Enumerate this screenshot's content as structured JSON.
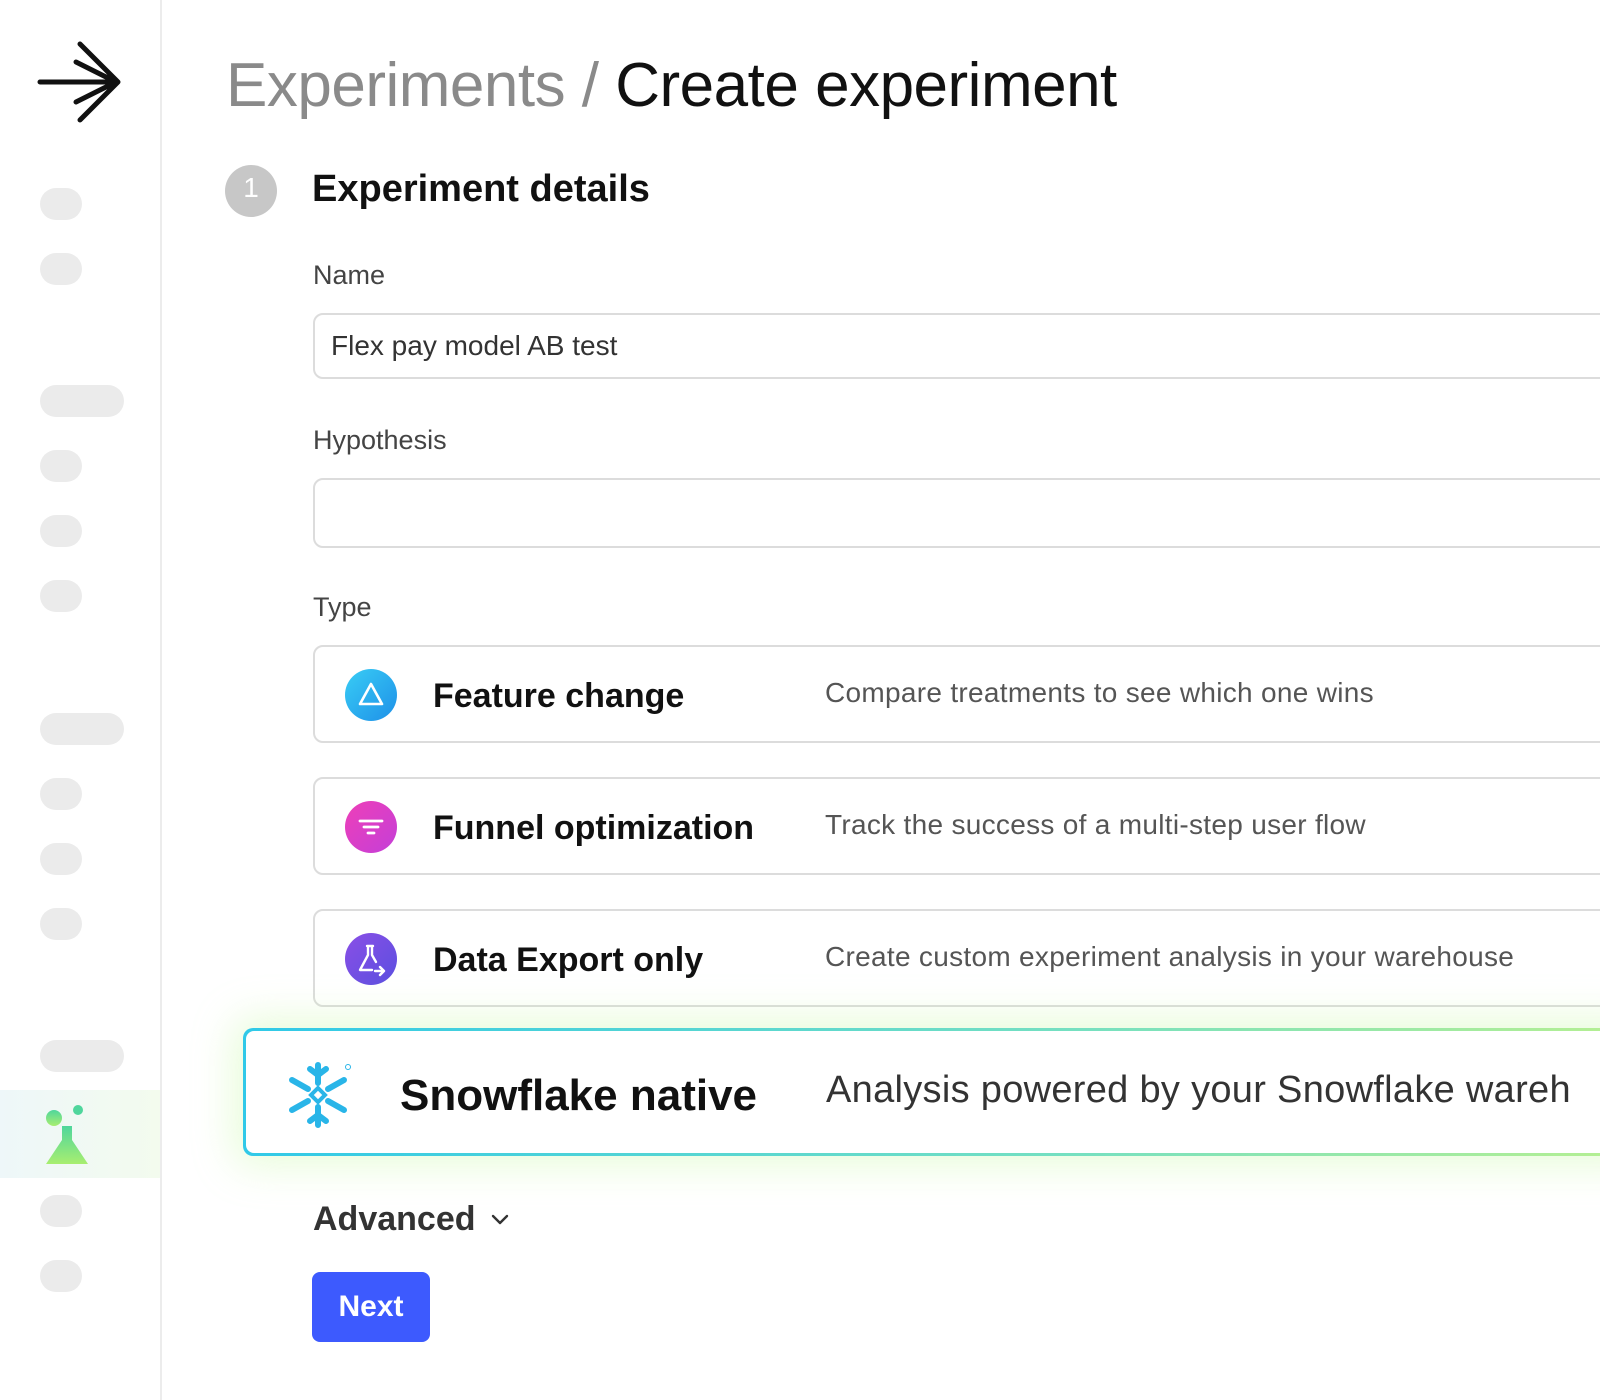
{
  "breadcrumb": {
    "parent": "Experiments",
    "separator": " / ",
    "current": "Create experiment"
  },
  "step": {
    "number": "1",
    "title": "Experiment details"
  },
  "form": {
    "name_label": "Name",
    "name_value": "Flex pay model AB test",
    "hypothesis_label": "Hypothesis",
    "hypothesis_value": "",
    "type_label": "Type"
  },
  "types": [
    {
      "name": "Feature change",
      "description": "Compare treatments to see which one wins",
      "icon": "triangle-icon",
      "color": "#2fb6ef"
    },
    {
      "name": "Funnel optimization",
      "description": "Track the success of a multi-step user flow",
      "icon": "funnel-icon",
      "color": "#d640c8"
    },
    {
      "name": "Data Export only",
      "description": "Create custom experiment analysis in your warehouse",
      "icon": "flask-export-icon",
      "color": "#6b4fe0"
    }
  ],
  "highlight": {
    "name": "Snowflake native",
    "description": "Analysis powered by your Snowflake wareh",
    "icon": "snowflake-icon",
    "color": "#29b5e8"
  },
  "advanced_label": "Advanced",
  "next_label": "Next",
  "accent": "#3d5afe"
}
